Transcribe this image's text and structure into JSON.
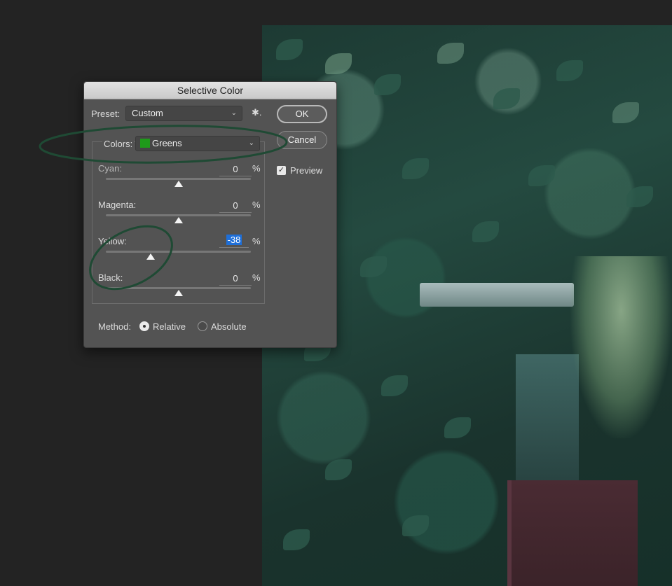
{
  "dialog": {
    "title": "Selective Color",
    "preset_label": "Preset:",
    "preset_value": "Custom",
    "gear_glyph": "✱.",
    "ok_label": "OK",
    "cancel_label": "Cancel",
    "preview_label": "Preview",
    "preview_checked": true,
    "colors_label": "Colors:",
    "colors_value": "Greens",
    "colors_swatch": "#1f9a1a",
    "sliders": [
      {
        "name": "Cyan:",
        "value": "0",
        "unit": "%",
        "level": 0
      },
      {
        "name": "Magenta:",
        "value": "0",
        "unit": "%",
        "level": 0
      },
      {
        "name": "Yellow:",
        "value": "-38",
        "unit": "%",
        "level": -38,
        "selected": true
      },
      {
        "name": "Black:",
        "value": "0",
        "unit": "%",
        "level": 0
      }
    ],
    "method_label": "Method:",
    "method_options": [
      {
        "label": "Relative",
        "checked": true
      },
      {
        "label": "Absolute",
        "checked": false
      }
    ]
  },
  "colors": {
    "background": "#232323",
    "dialog": "#535353",
    "annotation": "#1f4a34",
    "selection": "#1e6fd9"
  }
}
